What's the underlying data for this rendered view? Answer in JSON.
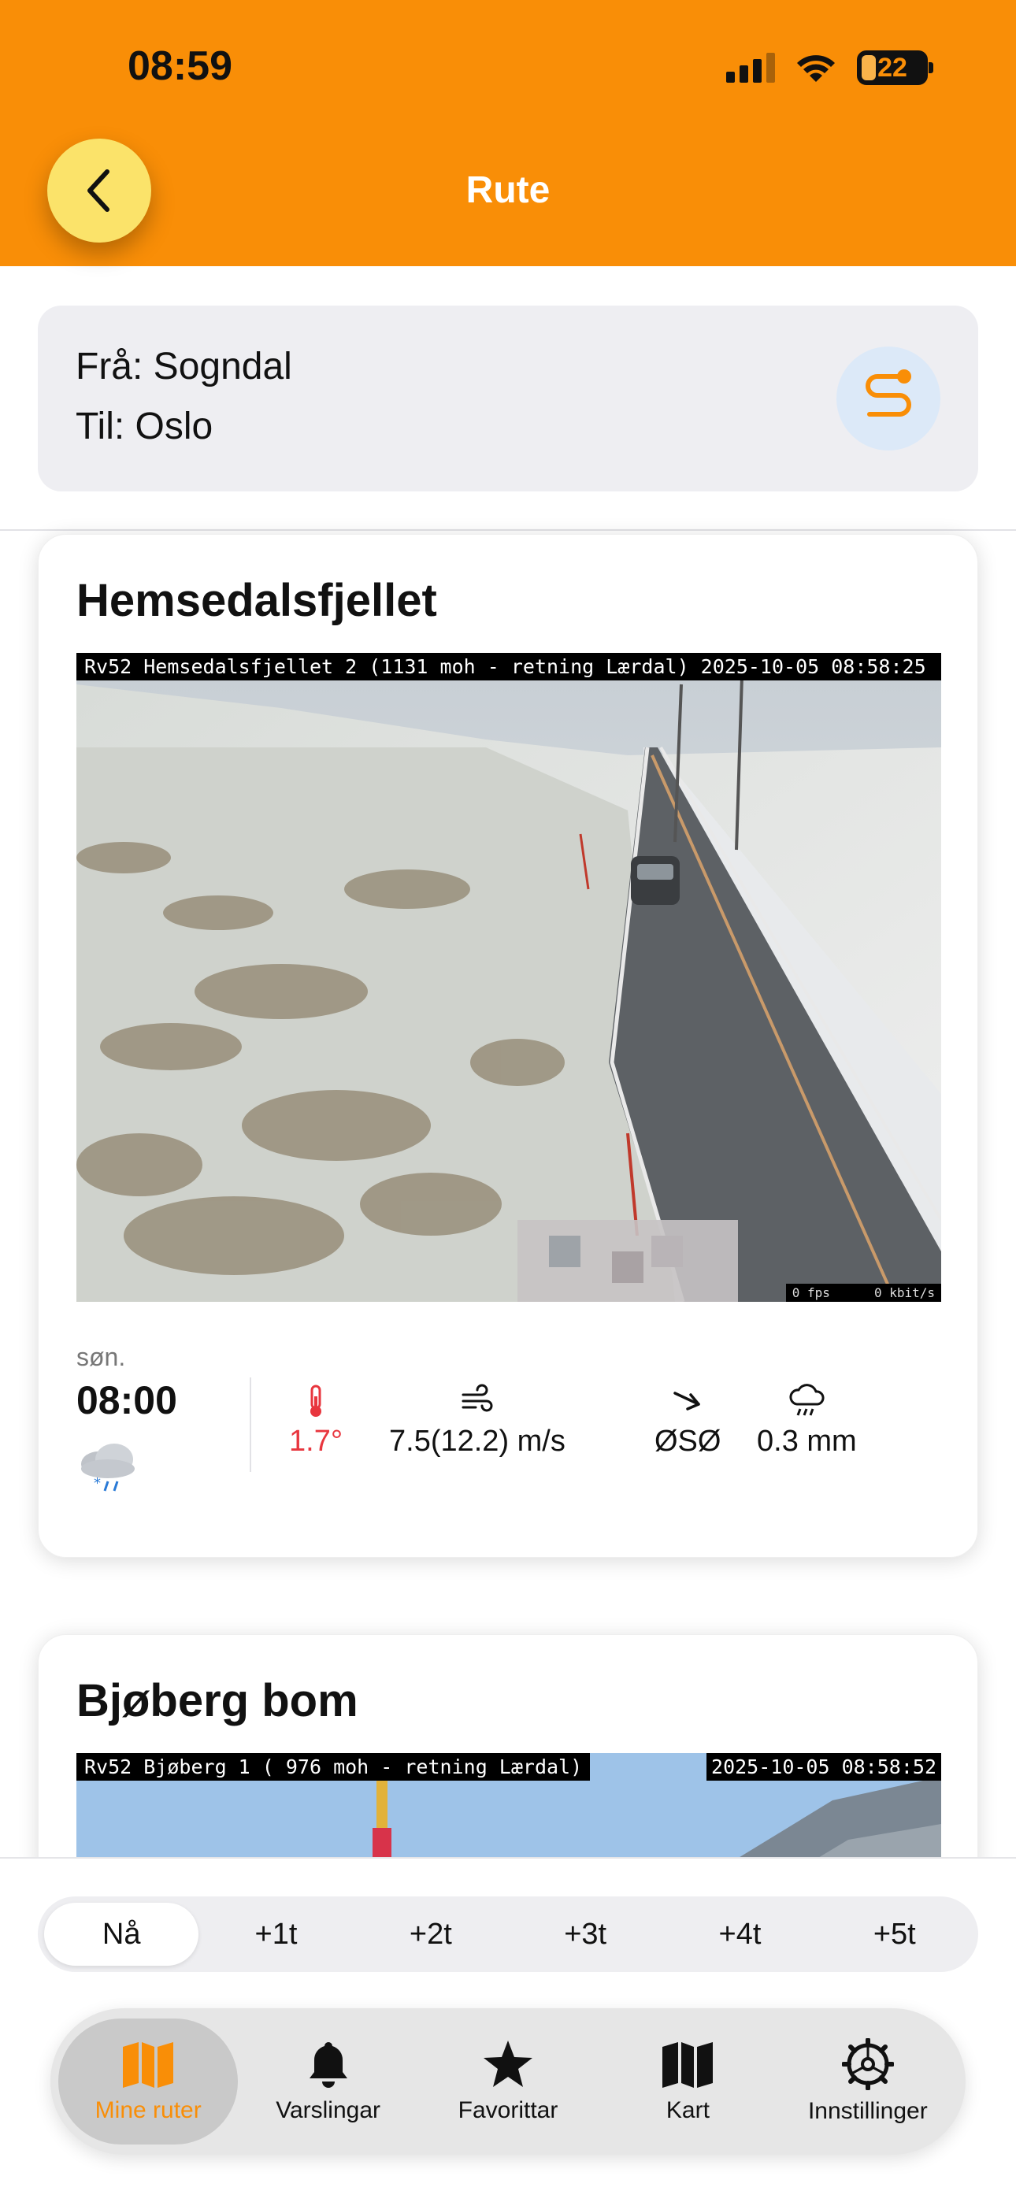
{
  "status_bar": {
    "time": "08:59",
    "battery": "22"
  },
  "header": {
    "title": "Rute"
  },
  "route": {
    "from": "Frå: Sogndal",
    "to": "Til: Oslo"
  },
  "cameras": [
    {
      "name": "Hemsedalsfjellet",
      "caption": "Rv52 Hemsedalsfjellet 2 (1131 moh - retning Lærdal) 2025-10-05 08:58:25",
      "fps": "0 fps",
      "kbit": "0 kbit/s",
      "weather": {
        "day": "søn.",
        "time": "08:00",
        "icon": "sleet-cloud-icon",
        "temperature": "1.7°",
        "wind": "7.5(12.2) m/s",
        "direction": "ØSØ",
        "precipitation": "0.3 mm"
      }
    },
    {
      "name": "Bjøberg bom",
      "caption": "Rv52 Bjøberg 1 ( 976 moh - retning Lærdal)",
      "timestamp": "2025-10-05 08:58:52"
    }
  ],
  "time_segments": [
    "Nå",
    "+1t",
    "+2t",
    "+3t",
    "+4t",
    "+5t"
  ],
  "active_segment": "Nå",
  "tabs": [
    {
      "label": "Mine ruter",
      "icon": "map-icon"
    },
    {
      "label": "Varslingar",
      "icon": "bell-icon"
    },
    {
      "label": "Favorittar",
      "icon": "star-icon"
    },
    {
      "label": "Kart",
      "icon": "map-icon"
    },
    {
      "label": "Innstillinger",
      "icon": "gear-icon"
    }
  ],
  "active_tab": "Mine ruter",
  "colors": {
    "accent": "#F98E07",
    "back_button": "#FBE36A",
    "temperature": "#E8363E",
    "route_icon_bg": "#DCE9F8"
  }
}
